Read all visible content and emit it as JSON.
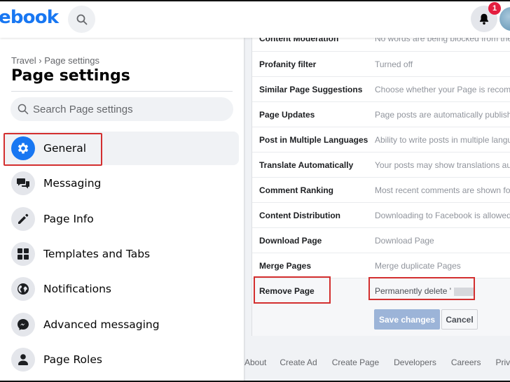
{
  "topbar": {
    "logo_text": "ebook",
    "notification_count": "1"
  },
  "sidebar": {
    "breadcrumb": "Travel › Page settings",
    "title": "Page settings",
    "search_placeholder": "Search Page settings",
    "items": [
      {
        "label": "General",
        "icon": "gear-icon",
        "active": true
      },
      {
        "label": "Messaging",
        "icon": "chat-bubbles-icon"
      },
      {
        "label": "Page Info",
        "icon": "pencil-icon"
      },
      {
        "label": "Templates and Tabs",
        "icon": "grid-icon"
      },
      {
        "label": "Notifications",
        "icon": "globe-icon"
      },
      {
        "label": "Advanced messaging",
        "icon": "messenger-icon"
      },
      {
        "label": "Page Roles",
        "icon": "person-icon"
      }
    ]
  },
  "settings": {
    "rows": [
      {
        "name": "Content Moderation",
        "value": "No words are being blocked from the"
      },
      {
        "name": "Profanity filter",
        "value": "Turned off"
      },
      {
        "name": "Similar Page Suggestions",
        "value": "Choose whether your Page is recomm"
      },
      {
        "name": "Page Updates",
        "value": "Page posts are automatically publishe"
      },
      {
        "name": "Post in Multiple Languages",
        "value": "Ability to write posts in multiple langua"
      },
      {
        "name": "Translate Automatically",
        "value": "Your posts may show translations aut"
      },
      {
        "name": "Comment Ranking",
        "value": "Most recent comments are shown for"
      },
      {
        "name": "Content Distribution",
        "value": "Downloading to Facebook is allowed."
      },
      {
        "name": "Download Page",
        "value": "Download Page"
      },
      {
        "name": "Merge Pages",
        "value": "Merge duplicate Pages"
      }
    ],
    "remove": {
      "name": "Remove Page",
      "value": "Permanently delete '"
    },
    "save_label": "Save changes",
    "cancel_label": "Cancel"
  },
  "footer": {
    "links": [
      "About",
      "Create Ad",
      "Create Page",
      "Developers",
      "Careers",
      "Privacy"
    ]
  },
  "colors": {
    "brand": "#1877f2",
    "highlight": "#d32f2f",
    "badge": "#e41e3f"
  }
}
